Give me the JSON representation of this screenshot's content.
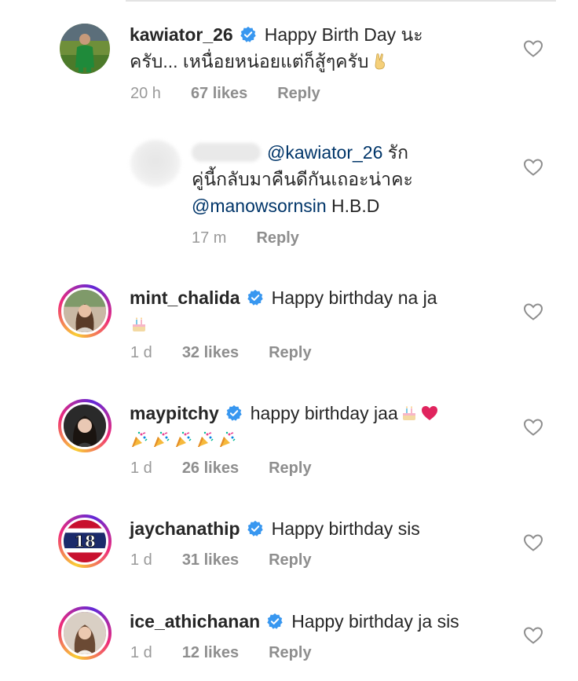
{
  "comments": [
    {
      "username": "kawiator_26",
      "verified": true,
      "text_line1": "Happy Birth Day นะ",
      "text_line2": "ครับ... เหนื่อยหน่อยแต่ก็สู้ๆครับ",
      "trailing_emoji": "victory-hand-emoji",
      "time": "20 h",
      "likes": "67 likes",
      "reply": "Reply"
    },
    {
      "username_blurred": true,
      "mention1": "@kawiator_26",
      "text_line1_rest": " รัก",
      "text_line2": "คู่นี้กลับมาคืนดีกันเถอะน่าคะ",
      "mention2": "@manowsornsin",
      "text_line3_rest": " H.B.D",
      "time": "17 m",
      "reply": "Reply"
    },
    {
      "username": "mint_chalida",
      "verified": true,
      "text_line1": "Happy birthday na ja",
      "emoji_line2": "birthday-cake-emoji",
      "time": "1 d",
      "likes": "32 likes",
      "reply": "Reply"
    },
    {
      "username": "maypitchy",
      "verified": true,
      "text_line1": "happy birthday jaa",
      "emoji_line1": [
        "birthday-cake-emoji",
        "red-heart-emoji"
      ],
      "emoji_line2": [
        "party-popper-emoji",
        "party-popper-emoji",
        "party-popper-emoji",
        "party-popper-emoji",
        "party-popper-emoji"
      ],
      "time": "1 d",
      "likes": "26 likes",
      "reply": "Reply"
    },
    {
      "username": "jaychanathip",
      "verified": true,
      "text_line1": "Happy birthday sis",
      "avatar_text": "18",
      "time": "1 d",
      "likes": "31 likes",
      "reply": "Reply"
    },
    {
      "username": "ice_athichanan",
      "verified": true,
      "text_line1": "Happy birthday ja sis",
      "time": "1 d",
      "likes": "12 likes",
      "reply": "Reply"
    }
  ],
  "colors": {
    "verified_badge": "#3897f0",
    "meta_text": "#8e8e8e",
    "mention": "#003569",
    "heart_outline": "#8e8e8e",
    "red_heart": "#e0245e"
  }
}
